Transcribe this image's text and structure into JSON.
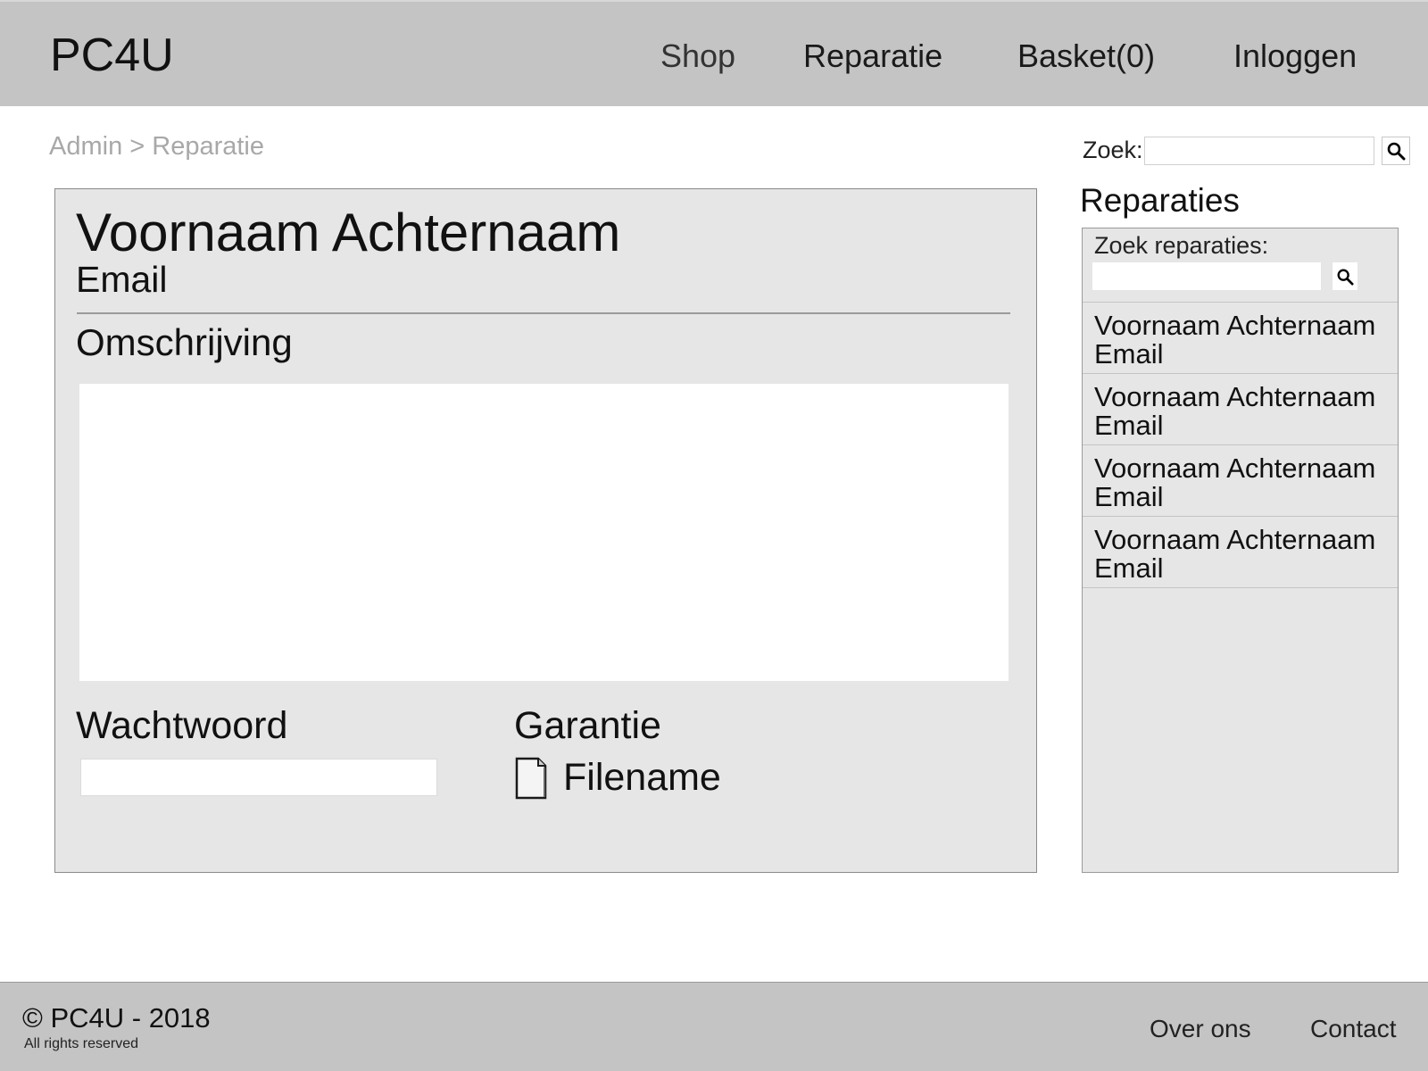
{
  "header": {
    "logo": "PC4U",
    "nav": {
      "shop": "Shop",
      "reparatie": "Reparatie",
      "basket": "Basket(0)",
      "login": "Inloggen"
    }
  },
  "breadcrumb": {
    "admin": "Admin",
    "separator": " > ",
    "current": "Reparatie"
  },
  "search": {
    "label": "Zoek:",
    "value": "",
    "icon": "search-icon"
  },
  "detail": {
    "name": "Voornaam Achternaam",
    "email": "Email",
    "description_label": "Omschrijving",
    "description_value": "",
    "password_label": "Wachtwoord",
    "password_value": "",
    "warranty_label": "Garantie",
    "file_icon": "file-icon",
    "file_name": "Filename"
  },
  "sidebar": {
    "title": "Reparaties",
    "search_label": "Zoek reparaties:",
    "search_value": "",
    "items": [
      {
        "name": "Voornaam Achternaam",
        "email": "Email"
      },
      {
        "name": "Voornaam Achternaam",
        "email": "Email"
      },
      {
        "name": "Voornaam Achternaam",
        "email": "Email"
      },
      {
        "name": "Voornaam Achternaam",
        "email": "Email"
      }
    ]
  },
  "footer": {
    "copyright": "© PC4U - 2018",
    "rights": "All rights reserved",
    "about": "Over ons",
    "contact": "Contact"
  },
  "colors": {
    "header_bg": "#c4c4c4",
    "panel_bg": "#e6e6e6",
    "breadcrumb": "#a8a8a8"
  }
}
